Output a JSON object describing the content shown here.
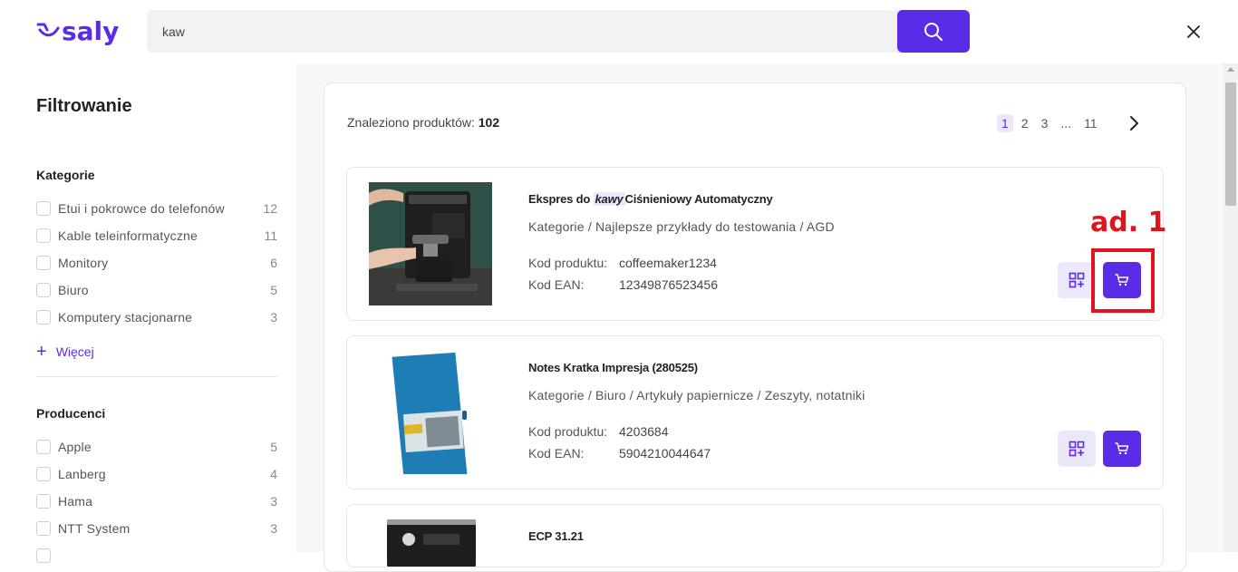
{
  "header": {
    "logo_text": "saly",
    "search": {
      "value": "kaw",
      "placeholder": ""
    },
    "search_icon": "search-icon",
    "close_icon": "close-icon"
  },
  "sidebar": {
    "title": "Filtrowanie",
    "categories": {
      "title": "Kategorie",
      "items": [
        {
          "label": "Etui i pokrowce do telefonów",
          "count": "12"
        },
        {
          "label": "Kable teleinformatyczne",
          "count": "11"
        },
        {
          "label": "Monitory",
          "count": "6"
        },
        {
          "label": "Biuro",
          "count": "5"
        },
        {
          "label": "Komputery stacjonarne",
          "count": "3"
        }
      ],
      "more_label": "Więcej"
    },
    "producers": {
      "title": "Producenci",
      "items": [
        {
          "label": "Apple",
          "count": "5"
        },
        {
          "label": "Lanberg",
          "count": "4"
        },
        {
          "label": "Hama",
          "count": "3"
        },
        {
          "label": "NTT System",
          "count": "3"
        }
      ]
    }
  },
  "results": {
    "found_label": "Znaleziono produktów:",
    "found_count": "102",
    "pagination": [
      "1",
      "2",
      "3",
      "...",
      "11"
    ],
    "active_page": "1",
    "products": [
      {
        "name_before": "Ekspres do",
        "name_highlight": "kawy",
        "name_after": "Ciśnieniowy Automatyczny",
        "category": "Kategorie / Najlepsze przykłady do testowania / AGD",
        "code_label": "Kod produktu:",
        "code": "coffeemaker1234",
        "ean_label": "Kod EAN:",
        "ean": "12349876523456"
      },
      {
        "name": "Notes Kratka Impresja (280525)",
        "category": "Kategorie / Biuro / Artykuły papiernicze / Zeszyty, notatniki",
        "code_label": "Kod produktu:",
        "code": "4203684",
        "ean_label": "Kod EAN:",
        "ean": "5904210044647"
      },
      {
        "name": "ECP 31.21"
      }
    ]
  },
  "annotation": {
    "label": "ad. 1",
    "color": "#e0141e"
  },
  "colors": {
    "accent": "#5b2ce8",
    "accent_light": "#ece8fb"
  }
}
